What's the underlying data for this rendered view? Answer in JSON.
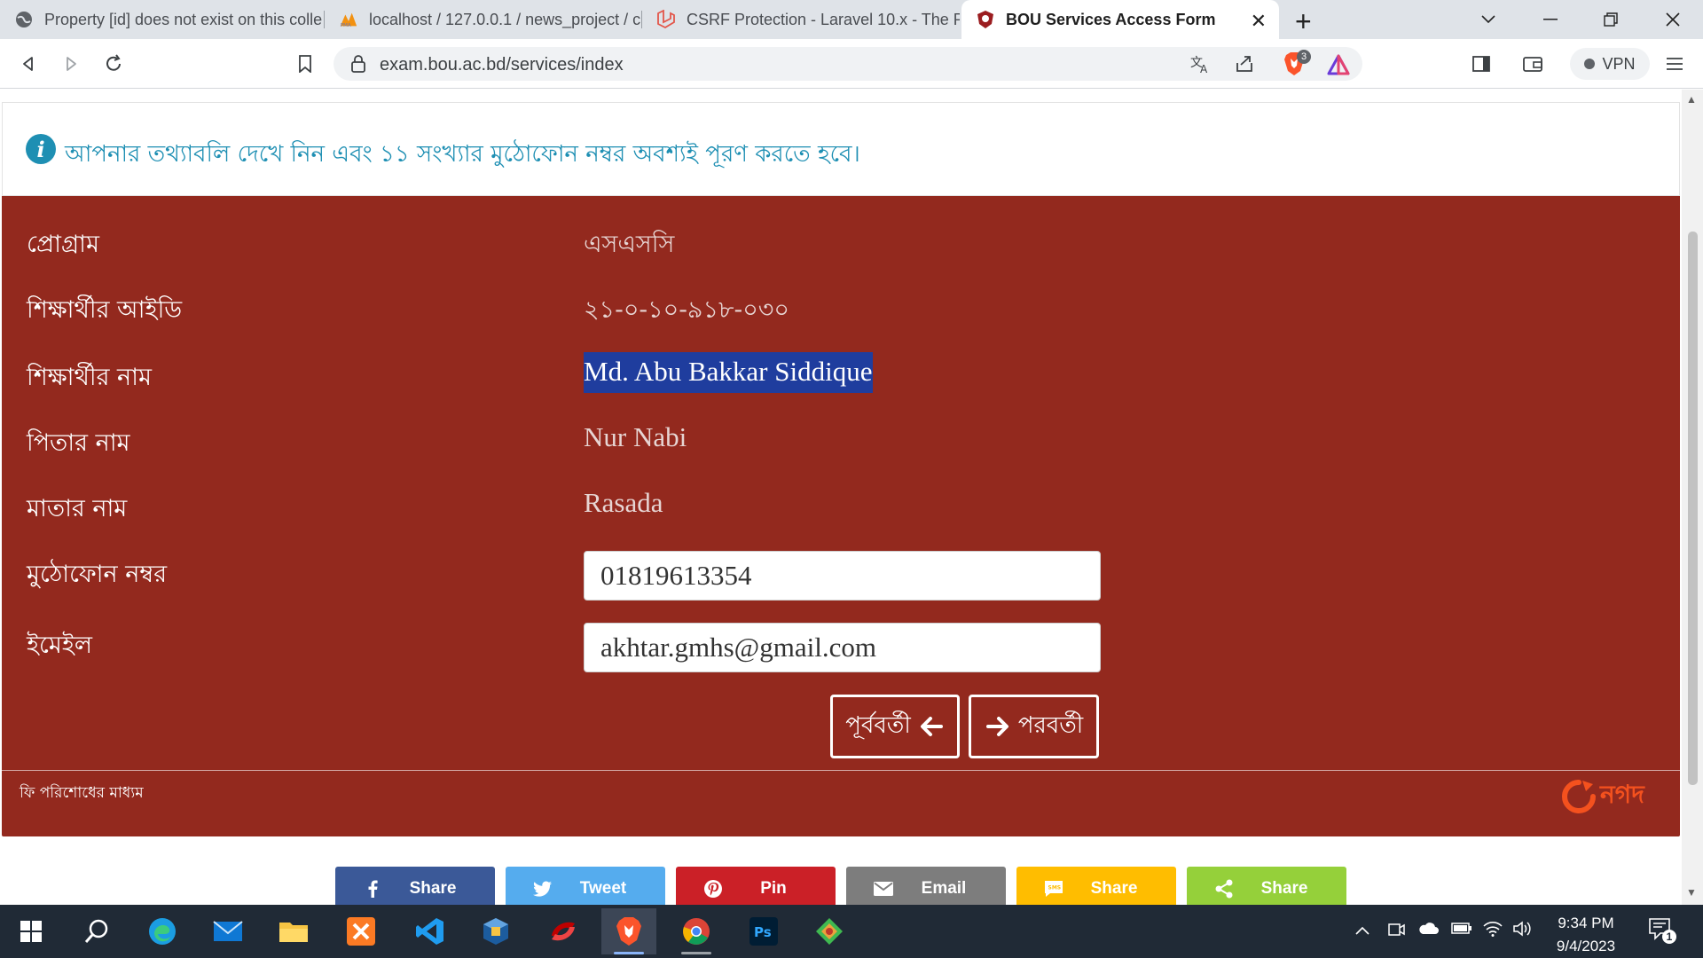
{
  "tabs": [
    {
      "title": "Property [id] does not exist on this colle",
      "icon": "globe-icon"
    },
    {
      "title": "localhost / 127.0.0.1 / news_project / c",
      "icon": "phpmyadmin-icon"
    },
    {
      "title": "CSRF Protection - Laravel 10.x - The PH",
      "icon": "laravel-icon"
    },
    {
      "title": "BOU Services Access Form",
      "icon": "bou-icon",
      "active": true
    }
  ],
  "browser": {
    "url": "exam.bou.ac.bd/services/index",
    "vpn_label": "VPN",
    "shield_count": "3"
  },
  "alert": {
    "text": "আপনার তথ্যাবলি দেখে নিন এবং ১১ সংখ্যার মুঠোফোন নম্বর অবশ্যই পূরণ করতে হবে।"
  },
  "form": {
    "rows": [
      {
        "label": "প্রোগ্রাম",
        "value": "এসএসসি"
      },
      {
        "label": "শিক্ষার্থীর আইডি",
        "value": "২১-০-১০-৯১৮-০৩০"
      },
      {
        "label": "শিক্ষার্থীর নাম",
        "value": "Md. Abu Bakkar Siddique"
      },
      {
        "label": "পিতার নাম",
        "value": "Nur Nabi"
      },
      {
        "label": "মাতার নাম",
        "value": "Rasada"
      }
    ],
    "phone": {
      "label": "মুঠোফোন নম্বর",
      "value": "01819613354"
    },
    "email": {
      "label": "ইমেইল",
      "value": "akhtar.gmhs@gmail.com"
    },
    "prev_label": "পূর্ববর্তী",
    "next_label": "পরবর্তী"
  },
  "footer": {
    "payment_text": "ফি পরিশোধের মাধ্যম",
    "payment_logo_text": "নগদ"
  },
  "share": [
    {
      "label": "Share",
      "icon": "facebook-icon",
      "color": "#3b5998"
    },
    {
      "label": "Tweet",
      "icon": "twitter-icon",
      "color": "#55acee"
    },
    {
      "label": "Pin",
      "icon": "pinterest-icon",
      "color": "#cb2027"
    },
    {
      "label": "Email",
      "icon": "email-icon",
      "color": "#7d7d7d"
    },
    {
      "label": "Share",
      "icon": "sms-icon",
      "color": "#ffbd00"
    },
    {
      "label": "Share",
      "icon": "share-icon",
      "color": "#95d03a"
    }
  ],
  "taskbar": {
    "time": "9:34 PM",
    "date": "9/4/2023",
    "notification_count": "1"
  },
  "colors": {
    "card_bg": "#93291e",
    "alert_text": "#1e8fb3",
    "selection": "#1f3d9e"
  }
}
